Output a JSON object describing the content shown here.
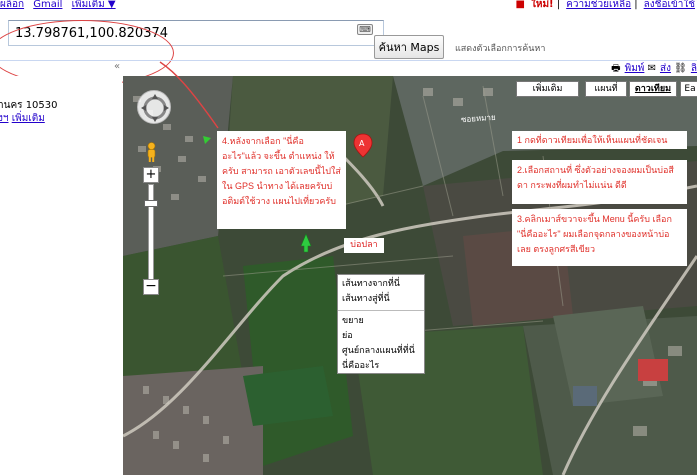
{
  "topbar": {
    "links_left": [
      "ผล็อก",
      "Gmail",
      "เพิ่มเติม ▼"
    ],
    "links_right": [
      "ใหม่!",
      "ความช่วยเหลือ",
      "ลงชื่อเข้าใช้"
    ]
  },
  "search": {
    "value": "13.798761,100.820374",
    "button_label": "ค้นหา Maps",
    "options_label": "แสดงตัวเลือกการค้นหา",
    "keyboard_icon": "keyboard-icon"
  },
  "subbar": {
    "collapse_label": "«",
    "print_label": "พิมพ์",
    "send_label": "ส่ง",
    "link_label": "ลิ"
  },
  "sidebar": {
    "address_fragment": "านคร 10530",
    "link_fragment": "งฯ",
    "more_label": "เพิ่มเติม"
  },
  "map": {
    "type_buttons": [
      "เพิ่มเติม",
      "แผนที่",
      "ดาวเทียม",
      "Ea"
    ],
    "zoom_in": "+",
    "zoom_out": "−",
    "road_label": "ซอยหมาย",
    "poi_label": "บ่อปลา",
    "marker_letter": "A"
  },
  "annotations": {
    "left_note": "4.หลังจากเลือก \"นี่คืออะไร\"แล้ว จะขึ้น ตำแหน่ง ให้ครับ สามารถ เอาตัวเลขนี้ไปใส่ใน GPS นำทาง ได้เลยครับบ่อติมต์ใช้วาง แผนไปเที่ยวครับ",
    "note1": "1 กดที่ดาวเทียมเพื่อให้เห็นแผนที่ชัดเจน",
    "note2": "2.เลือกสถานที่ ซึ่งตัวอย่างจองผมเป็นบ่อสีดา กระพงที่ผมทำไม่แน่น ดีดี",
    "note3": "3.คลิกเมาส์ขวาจะขึ้น Menu นี้ครับ เลือก \"นี่คืออะไร\" ผมเลือกจุดกลางของหน้าบ่อเลย ตรงลูกศรสีเขียว"
  },
  "context_menu": {
    "items_top": [
      "เส้นทางจากที่นี่",
      "เส้นทางสู่ที่นี่"
    ],
    "items_bottom": [
      "ขยาย",
      "ย่อ",
      "ศูนย์กลางแผนที่ที่นี่",
      "นี่คืออะไร"
    ]
  },
  "colors": {
    "annotation_red": "#e0302a",
    "link_blue": "#2200cc",
    "ellipse_red": "#d44444"
  }
}
